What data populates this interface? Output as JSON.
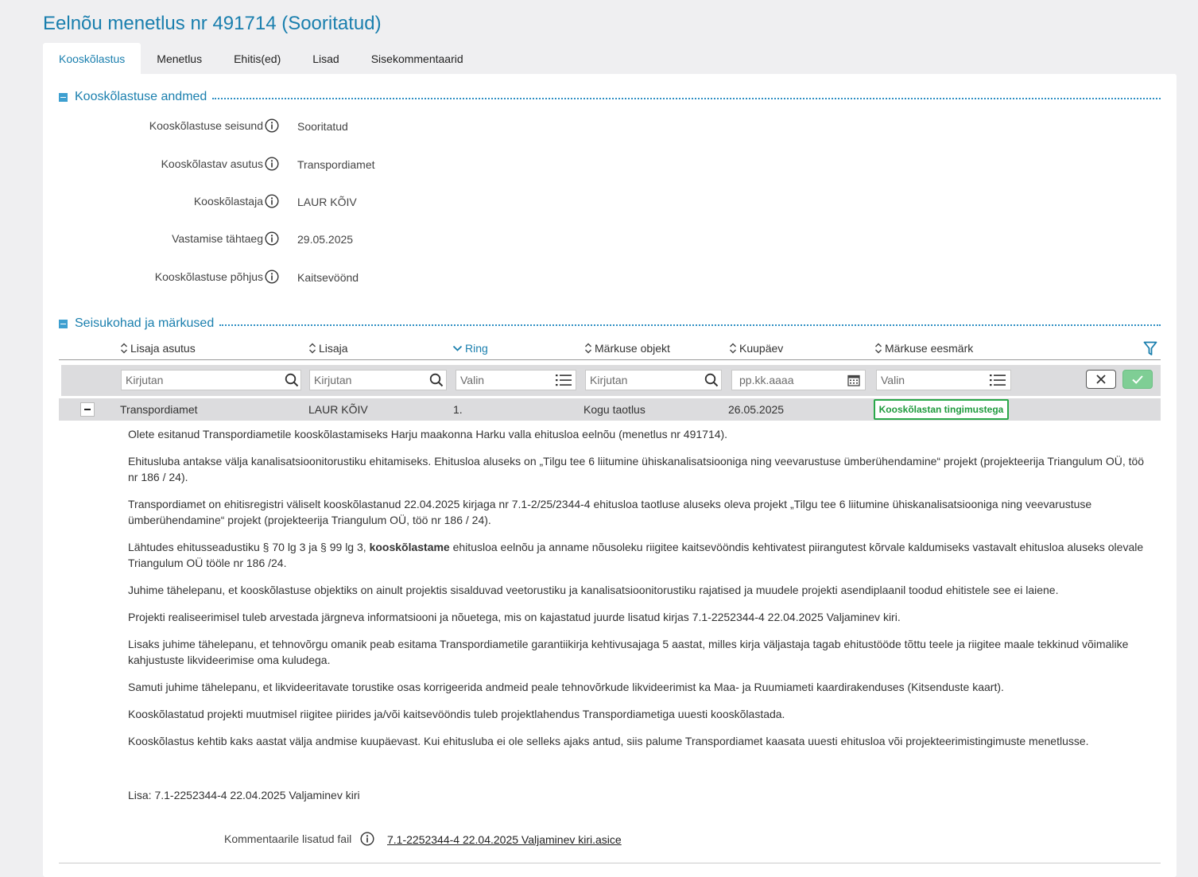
{
  "page": {
    "title": "Eelnõu menetlus nr 491714 (Sooritatud)"
  },
  "tabs": [
    "Kooskõlastus",
    "Menetlus",
    "Ehitis(ed)",
    "Lisad",
    "Sisekommentaarid"
  ],
  "section1": {
    "title": "Kooskõlastuse andmed",
    "fields": [
      {
        "label": "Kooskõlastuse seisund",
        "value": "Sooritatud"
      },
      {
        "label": "Kooskõlastav asutus",
        "value": "Transpordiamet"
      },
      {
        "label": "Kooskõlastaja",
        "value": "LAUR KÕIV"
      },
      {
        "label": "Vastamise tähtaeg",
        "value": "29.05.2025"
      },
      {
        "label": "Kooskõlastuse põhjus",
        "value": "Kaitsevöönd"
      }
    ]
  },
  "section2": {
    "title": "Seisukohad ja märkused",
    "columns": [
      "Lisaja asutus",
      "Lisaja",
      "Ring",
      "Märkuse objekt",
      "Kuupäev",
      "Märkuse eesmärk"
    ],
    "filters": {
      "lisaja_asutus": "Kirjutan",
      "lisaja": "Kirjutan",
      "ring": "Valin",
      "markuse_objekt": "Kirjutan",
      "kuupaev": "pp.kk.aaaa",
      "markuse_eesmark": "Valin"
    },
    "row": {
      "asutus": "Transpordiamet",
      "lisaja": "LAUR KÕIV",
      "ring": "1.",
      "objekt": "Kogu taotlus",
      "kuupaev": "26.05.2025",
      "eesmark": "Kooskõlastan tingimustega"
    },
    "comment": {
      "p1": "Olete esitanud Transpordiametile kooskõlastamiseks Harju maakonna Harku valla ehitusloa eelnõu (menetlus nr 491714).",
      "p2": "Ehitusluba antakse välja kanalisatsioonitorustiku ehitamiseks. Ehitusloa aluseks on „Tilgu tee 6 liitumine ühiskanalisatsiooniga ning veevarustuse ümberühendamine“ projekt (projekteerija Triangulum OÜ, töö nr 186 / 24).",
      "p3": "Transpordiamet on ehitisregistri väliselt kooskõlastanud 22.04.2025 kirjaga nr 7.1-2/25/2344-4 ehitusloa taotluse aluseks oleva projekt „Tilgu tee 6 liitumine ühiskanalisatsiooniga ning veevarustuse ümberühendamine“ projekt (projekteerija Triangulum OÜ, töö nr 186 / 24).",
      "p4_before": "Lähtudes ehitusseadustiku § 70 lg 3 ja § 99 lg 3, ",
      "p4_bold": "kooskõlastame",
      "p4_after": " ehitusloa eelnõu ja anname nõusoleku riigitee kaitsevööndis kehtivatest piirangutest kõrvale kaldumiseks vastavalt ehitusloa aluseks olevale Triangulum OÜ tööle nr 186 /24.",
      "p5": "Juhime tähelepanu, et kooskõlastuse objektiks on ainult projektis sisalduvad veetorustiku ja kanalisatsioonitorustiku rajatised ja muudele projekti asendiplaanil toodud ehitistele see ei laiene.",
      "p6": "Projekti realiseerimisel tuleb arvestada järgneva informatsiooni ja nõuetega, mis on kajastatud juurde lisatud kirjas 7.1-2252344-4 22.04.2025 Valjaminev kiri.",
      "p7": "Lisaks juhime tähelepanu, et tehnovõrgu omanik peab esitama Transpordiametile garantiikirja kehtivusajaga 5 aastat, milles kirja väljastaja tagab ehitustööde tõttu teele ja riigitee maale tekkinud võimalike kahjustuste likvideerimise oma kuludega.",
      "p8": "Samuti juhime tähelepanu, et likvideeritavate torustike osas korrigeerida andmeid peale tehnovõrkude likvideerimist ka Maa- ja Ruumiameti kaardirakenduses (Kitsenduste kaart).",
      "p9": "Kooskõlastatud projekti muutmisel riigitee piirides ja/või kaitsevööndis tuleb projektlahendus Transpordiametiga uuesti kooskõlastada.",
      "p10": "Kooskõlastus kehtib kaks aastat välja andmise kuupäevast. Kui ehitusluba ei ole selleks ajaks antud, siis palume Transpordiamet kaasata uuesti ehitusloa või projekteerimistingimuste menetlusse.",
      "p11": "Lisa: 7.1-2252344-4 22.04.2025 Valjaminev kiri"
    },
    "attachment": {
      "label": "Kommentaarile lisatud fail",
      "file": "7.1-2252344-4 22.04.2025 Valjaminev kiri.asice"
    }
  },
  "colors": {
    "accent": "#1a7fae",
    "success": "#2aa84a",
    "row_bg": "#dcdcde"
  }
}
